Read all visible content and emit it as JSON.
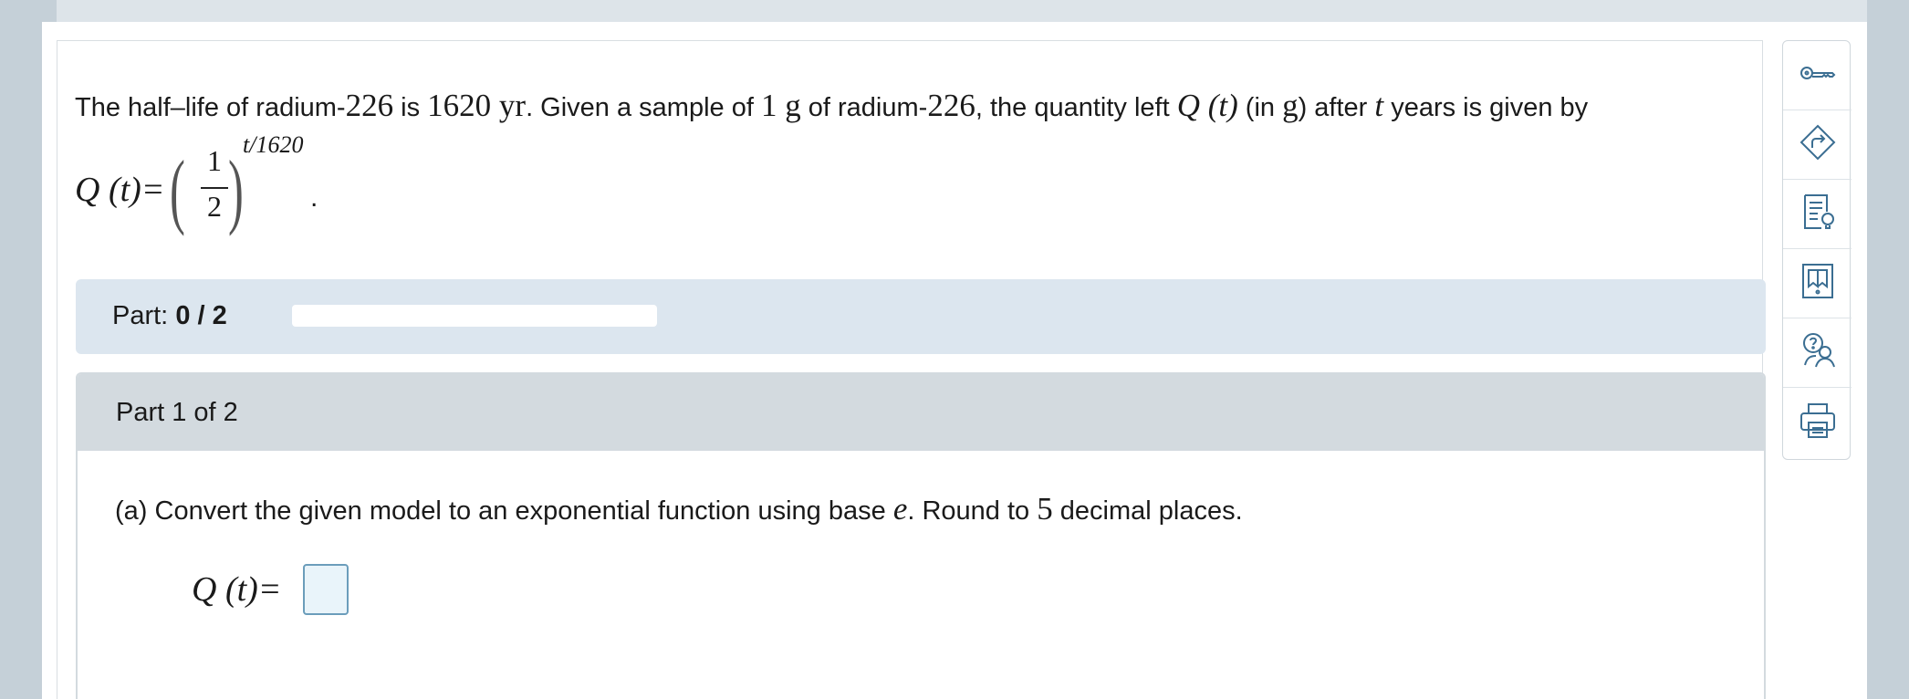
{
  "problem": {
    "t1": "The half–life of radium-",
    "n226": "226",
    "t2": " is ",
    "n1620": "1620",
    "unit_yr": " yr",
    "t3": ". Given a sample of ",
    "n1": "1",
    "unit_g": " g",
    "t4": " of radium-",
    "n226b": "226",
    "t5": ", the quantity left ",
    "qt": "Q (t)",
    "t6": " (in ",
    "g2": "g",
    "t7": ") after ",
    "tvar": "t",
    "t8": " years is given by"
  },
  "formula": {
    "lhs": "Q (t)=",
    "num": "1",
    "den": "2",
    "exponent": "t/1620",
    "period": "."
  },
  "part_bar": {
    "label": "Part:",
    "value": "0 / 2",
    "progress": 0
  },
  "section": {
    "title": "Part 1 of 2"
  },
  "question": {
    "t1": "(a) Convert the given model to an exponential function using base ",
    "e": "e",
    "t2": ". Round to ",
    "n5": "5",
    "t3": " decimal places."
  },
  "answer": {
    "label": "Q (t)=",
    "value": ""
  },
  "toolbar": {
    "icons": [
      "key-icon",
      "directions-icon",
      "explanation-icon",
      "ebook-icon",
      "ask-help-icon",
      "print-icon"
    ]
  },
  "colors": {
    "accent": "#3b6e92",
    "part_bar_bg": "#dce6ef",
    "section_head_bg": "#d3dadf",
    "answer_box_bg": "#e9f4fa"
  }
}
